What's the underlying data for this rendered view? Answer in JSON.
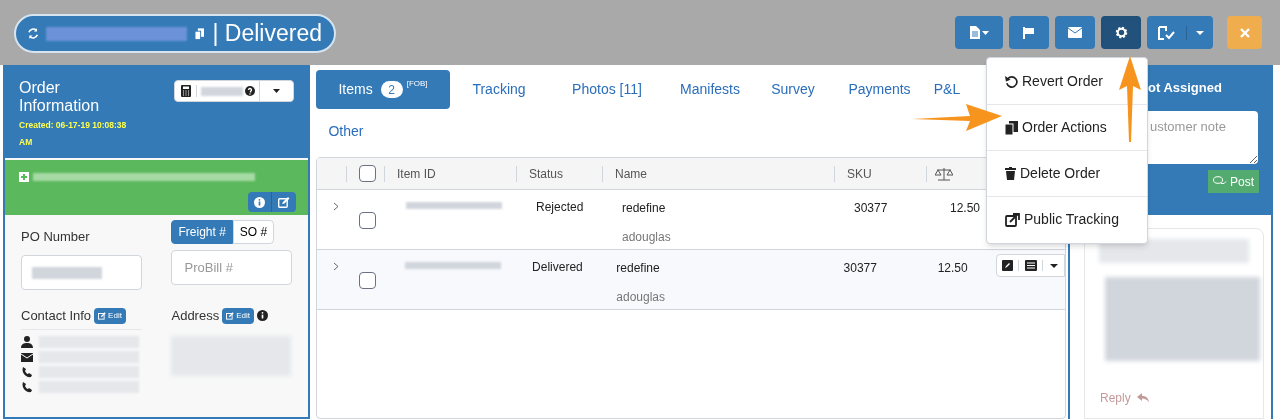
{
  "header": {
    "title": "| Delivered"
  },
  "toolbar": {
    "settings_open": true
  },
  "order_info": {
    "title": "Order Information",
    "created": "Created: 06-17-19 10:08:38 AM"
  },
  "po": {
    "label": "PO Number"
  },
  "freight_toggle": [
    {
      "label": "Freight #",
      "selected": true
    },
    {
      "label": "SO #",
      "selected": false
    }
  ],
  "probill": {
    "placeholder": "ProBill #"
  },
  "contact": {
    "label": "Contact Info",
    "edit": "Edit"
  },
  "address": {
    "label": "Address",
    "edit": "Edit"
  },
  "tabs": [
    {
      "label": "Items",
      "badge": "2",
      "note": "[FOB]",
      "selected": true
    },
    {
      "label": "Tracking",
      "selected": false
    },
    {
      "label": "Photos [11]",
      "selected": false
    },
    {
      "label": "Manifests",
      "selected": false
    },
    {
      "label": "Survey",
      "selected": false
    },
    {
      "label": "Payments",
      "selected": false
    },
    {
      "label": "P&L",
      "selected": false
    },
    {
      "label": "Other",
      "selected": false
    }
  ],
  "table": {
    "all_checked": false,
    "columns": [
      "Item ID",
      "Status",
      "Name",
      "SKU"
    ],
    "rows": [
      {
        "status": "Rejected",
        "name": "redefine",
        "user": "adouglas",
        "sku": "30377",
        "weight": "12.50",
        "highlighted": false,
        "checked": false
      },
      {
        "status": "Delivered",
        "name": "redefine",
        "user": "adouglas",
        "sku": "30377",
        "weight": "12.50",
        "highlighted": true,
        "checked": false
      }
    ]
  },
  "menu": {
    "items": [
      {
        "kind": "revert",
        "label": "Revert Order"
      },
      {
        "kind": "copy",
        "label": "Order Actions"
      },
      {
        "kind": "delete",
        "label": "Delete Order"
      },
      {
        "kind": "external",
        "label": "Public Tracking"
      }
    ]
  },
  "notes": {
    "header": "ot Assigned",
    "placeholder": "ustomer note",
    "post": "Post",
    "reply": "Reply"
  }
}
